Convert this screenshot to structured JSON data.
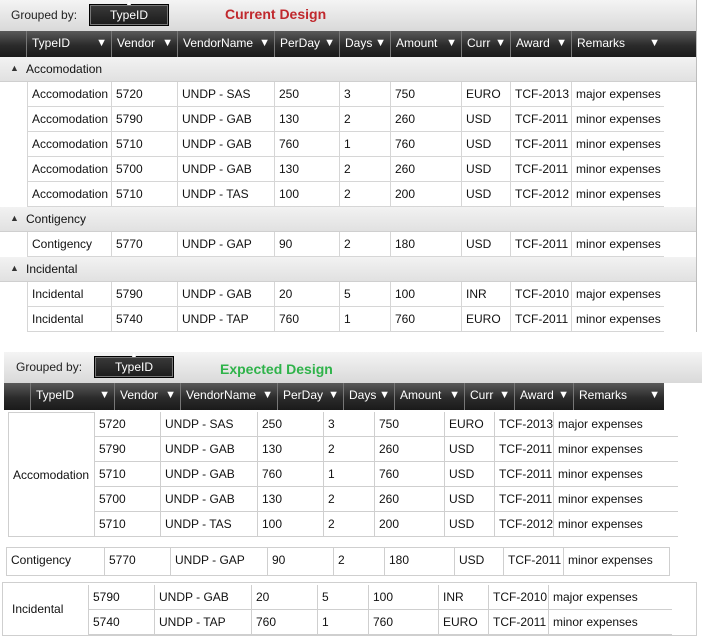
{
  "grouped_by_label": "Grouped by:",
  "group_chip_label": "TypeID",
  "current_title": "Current Design",
  "expected_title": "Expected Design",
  "colors": {
    "current_title": "#c0282d",
    "expected_title": "#2fb34a"
  },
  "columns": [
    "TypeID",
    "Vendor",
    "VendorName",
    "PerDay",
    "Days",
    "Amount",
    "Curr",
    "Award",
    "Remarks"
  ],
  "groups": [
    {
      "name": "Accomodation",
      "rows": [
        [
          "Accomodation",
          "5720",
          "UNDP - SAS",
          "250",
          "3",
          "750",
          "EURO",
          "TCF-2013",
          "major expenses"
        ],
        [
          "Accomodation",
          "5790",
          "UNDP - GAB",
          "130",
          "2",
          "260",
          "USD",
          "TCF-2011",
          "minor expenses"
        ],
        [
          "Accomodation",
          "5710",
          "UNDP - GAB",
          "760",
          "1",
          "760",
          "USD",
          "TCF-2011",
          "minor expenses"
        ],
        [
          "Accomodation",
          "5700",
          "UNDP - GAB",
          "130",
          "2",
          "260",
          "USD",
          "TCF-2011",
          "minor expenses"
        ],
        [
          "Accomodation",
          "5710",
          "UNDP - TAS",
          "100",
          "2",
          "200",
          "USD",
          "TCF-2012",
          "minor expenses"
        ]
      ]
    },
    {
      "name": "Contigency",
      "rows": [
        [
          "Contigency",
          "5770",
          "UNDP - GAP",
          "90",
          "2",
          "180",
          "USD",
          "TCF-2011",
          "minor expenses"
        ]
      ]
    },
    {
      "name": "Incidental",
      "rows": [
        [
          "Incidental",
          "5790",
          "UNDP - GAB",
          "20",
          "5",
          "100",
          "INR",
          "TCF-2010",
          "major expenses"
        ],
        [
          "Incidental",
          "5740",
          "UNDP - TAP",
          "760",
          "1",
          "760",
          "EURO",
          "TCF-2011",
          "minor expenses"
        ]
      ]
    }
  ]
}
